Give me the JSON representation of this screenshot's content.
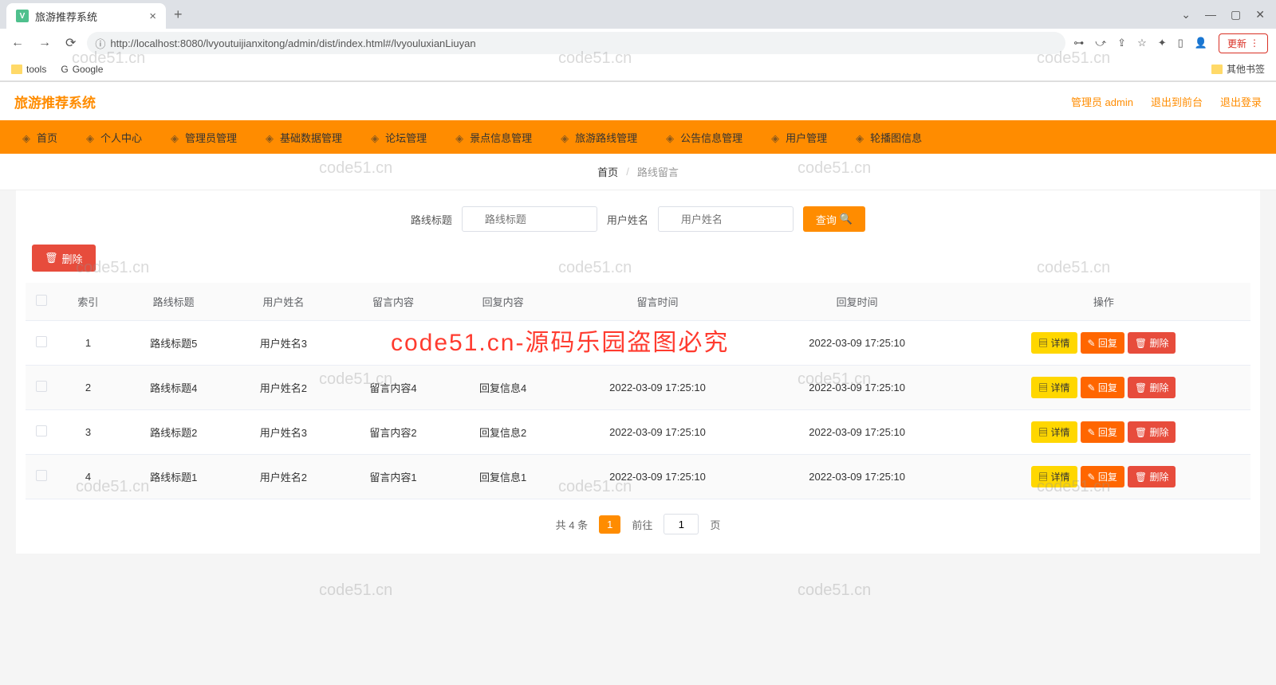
{
  "browser": {
    "tab_title": "旅游推荐系统",
    "url": "http://localhost:8080/lvyoutuijianxitong/admin/dist/index.html#/lvyouluxianLiuyan",
    "update_label": "更新",
    "bookmarks": {
      "tools": "tools",
      "google": "Google",
      "other": "其他书签"
    }
  },
  "app": {
    "title": "旅游推荐系统",
    "header_links": {
      "admin": "管理员 admin",
      "front": "退出到前台",
      "logout": "退出登录"
    }
  },
  "nav": [
    {
      "label": "首页"
    },
    {
      "label": "个人中心"
    },
    {
      "label": "管理员管理"
    },
    {
      "label": "基础数据管理"
    },
    {
      "label": "论坛管理"
    },
    {
      "label": "景点信息管理"
    },
    {
      "label": "旅游路线管理"
    },
    {
      "label": "公告信息管理"
    },
    {
      "label": "用户管理"
    },
    {
      "label": "轮播图信息"
    }
  ],
  "breadcrumb": {
    "home": "首页",
    "current": "路线留言"
  },
  "search": {
    "label_title": "路线标题",
    "ph_title": "路线标题",
    "label_user": "用户姓名",
    "ph_user": "用户姓名",
    "btn": "查询"
  },
  "delete_btn": "删除",
  "table": {
    "headers": {
      "index": "索引",
      "title": "路线标题",
      "user": "用户姓名",
      "msg": "留言内容",
      "reply": "回复内容",
      "msg_time": "留言时间",
      "reply_time": "回复时间",
      "ops": "操作"
    },
    "rows": [
      {
        "idx": "1",
        "title": "路线标题5",
        "user": "用户姓名3",
        "msg": "",
        "reply": "",
        "msg_time": "",
        "reply_time": "2022-03-09 17:25:10"
      },
      {
        "idx": "2",
        "title": "路线标题4",
        "user": "用户姓名2",
        "msg": "留言内容4",
        "reply": "回复信息4",
        "msg_time": "2022-03-09 17:25:10",
        "reply_time": "2022-03-09 17:25:10"
      },
      {
        "idx": "3",
        "title": "路线标题2",
        "user": "用户姓名3",
        "msg": "留言内容2",
        "reply": "回复信息2",
        "msg_time": "2022-03-09 17:25:10",
        "reply_time": "2022-03-09 17:25:10"
      },
      {
        "idx": "4",
        "title": "路线标题1",
        "user": "用户姓名2",
        "msg": "留言内容1",
        "reply": "回复信息1",
        "msg_time": "2022-03-09 17:25:10",
        "reply_time": "2022-03-09 17:25:10"
      }
    ],
    "op_detail": "详情",
    "op_reply": "回复",
    "op_delete": "删除"
  },
  "pagination": {
    "total": "共 4 条",
    "current": "1",
    "goto_pre": "前往",
    "goto_post": "页",
    "page": "1"
  },
  "watermarks": {
    "text": "code51.cn",
    "red": "code51.cn-源码乐园盗图必究"
  }
}
